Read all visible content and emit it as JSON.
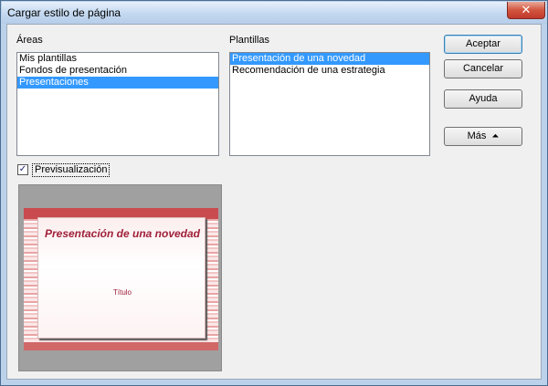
{
  "window": {
    "title": "Cargar estilo de página",
    "close_glyph": "✕"
  },
  "areas": {
    "label": "Áreas",
    "items": [
      {
        "label": "Mis plantillas",
        "selected": false
      },
      {
        "label": "Fondos de presentación",
        "selected": false
      },
      {
        "label": "Presentaciones",
        "selected": true
      }
    ]
  },
  "plantillas": {
    "label": "Plantillas",
    "items": [
      {
        "label": "Presentación de una novedad",
        "selected": true
      },
      {
        "label": "Recomendación de una estrategia",
        "selected": false
      }
    ]
  },
  "buttons": {
    "accept": "Aceptar",
    "cancel": "Cancelar",
    "help": "Ayuda",
    "more": "Más",
    "more_glyph": "⏶"
  },
  "preview_checkbox": {
    "label": "Previsualización",
    "checked": true,
    "check_glyph": "✓"
  },
  "preview": {
    "slide_title": "Presentación de una novedad",
    "slide_subtitle": "Título",
    "colors": {
      "accent": "#c94b50",
      "text": "#a0203a"
    }
  }
}
